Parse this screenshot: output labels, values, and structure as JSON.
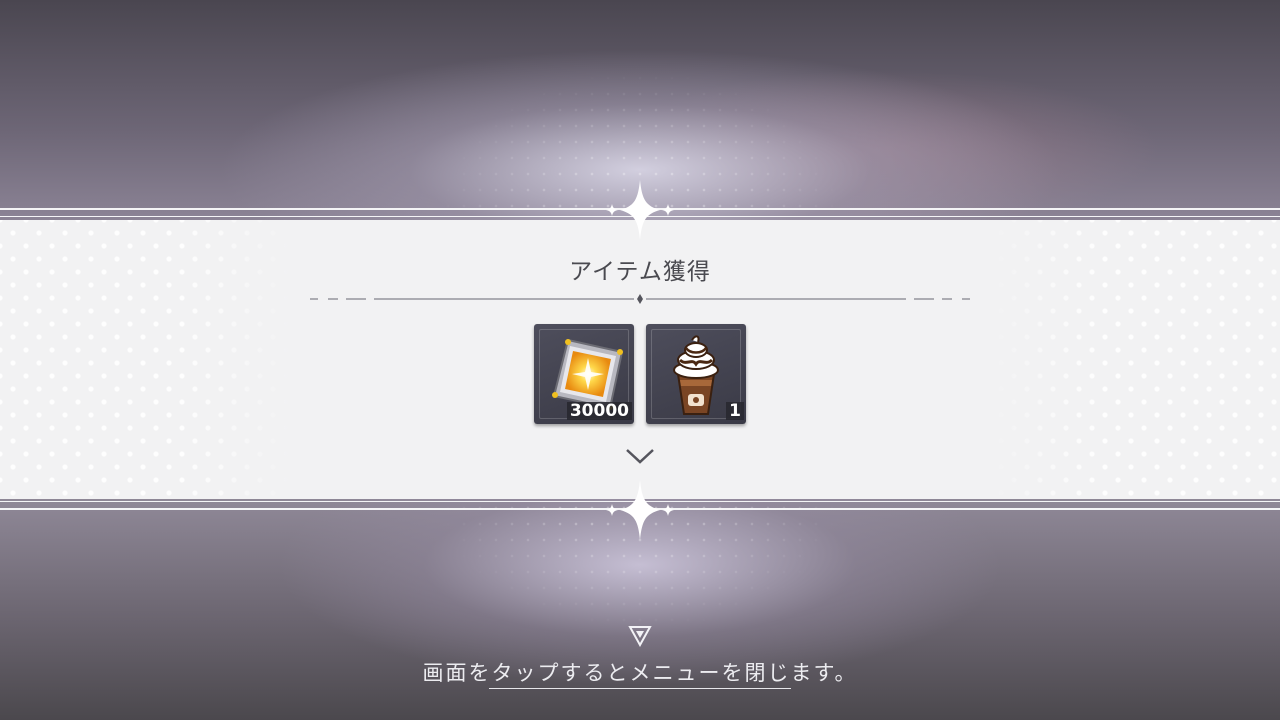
{
  "dialog": {
    "title": "アイテム獲得"
  },
  "items": [
    {
      "icon": "gold-crystal-icon",
      "quantity": "30000"
    },
    {
      "icon": "chocolate-frappe-icon",
      "quantity": "1"
    }
  ],
  "footer": {
    "hint": "画面をタップするとメニューを閉じます。"
  },
  "colors": {
    "band": "#f2f2f3",
    "title_text": "#4a4a50",
    "slot": "#44444f",
    "hint_text": "#ececf0"
  }
}
